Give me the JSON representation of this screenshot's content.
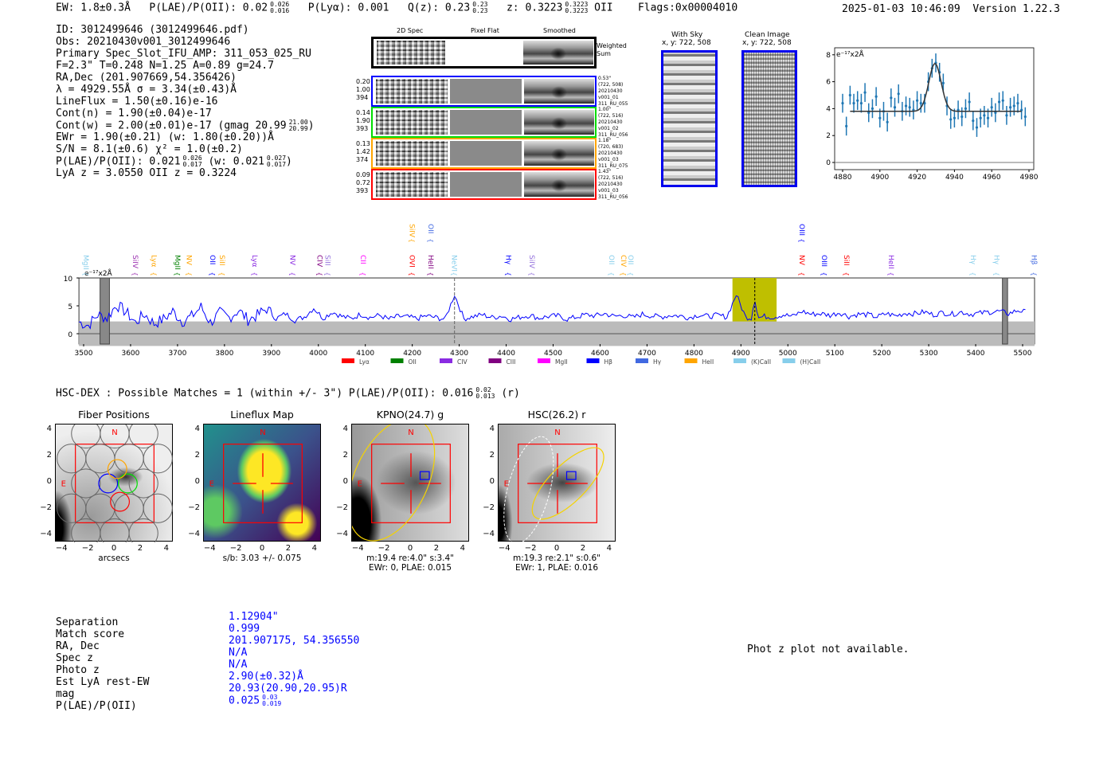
{
  "header": {
    "ew": "EW: 1.8±0.3Å",
    "plae_label": "P(LAE)/P(OII): 0.02",
    "plae_hi": "0.026",
    "plae_lo": "0.016",
    "plya": "P(Lyα): 0.001",
    "qz_label": "Q(z): 0.23",
    "qz_hi": "0.23",
    "qz_lo": "0.23",
    "z_label": "z: 0.3223",
    "z_hi": "0.3223",
    "z_lo": "0.3223",
    "z_line": "OII",
    "flags": "Flags:0x00004010",
    "datetime": "2025-01-03 10:46:09",
    "version": "Version 1.22.3"
  },
  "info": {
    "id": "ID: 3012499646 (3012499646.pdf)",
    "obs": "Obs: 20210430v001_3012499646",
    "primary": "Primary Spec_Slot_IFU_AMP: 311_053_025_RU",
    "params": "F=2.3\"  T=0.248  N=1.25  A=0.89  g=24.7",
    "radec": "RA,Dec (201.907669,54.356426)",
    "lambda": "λ = 4929.55Å   σ = 3.34(±0.43)Å",
    "lineflux": "LineFlux = 1.50(±0.16)e-16",
    "cont_n": "Cont(n) = 1.90(±0.04)e-17",
    "cont_w": "Cont(w) = 2.00(±0.01)e-17 (gmag 20.99",
    "cont_w_hi": "21.00",
    "cont_w_lo": "20.99",
    "cont_w_end": ")",
    "ewr": "EWr = 1.90(±0.21) (w: 1.80(±0.20))Å",
    "sn": "S/N = 8.1(±0.6)  χ² = 1.0(±0.2)",
    "plae": "P(LAE)/P(OII): 0.021",
    "plae_hi": "0.026",
    "plae_lo": "0.017",
    "plae_w": "(w: 0.021",
    "plae_w_hi": "0.027",
    "plae_w_lo": "0.017",
    "plae_w_end": ")",
    "z": "LyA z = 3.0550   OII z = 0.3224"
  },
  "spec2d": {
    "col_titles": [
      "2D Spec",
      "Pixel Flat",
      "Smoothed"
    ],
    "weighted_sum": "Weighted Sum",
    "rows": [
      {
        "color": "#0000ff",
        "vals": [
          "0.20",
          "1.00",
          "394"
        ],
        "meta": [
          "0.53\"",
          "(722, 508)",
          "20210430",
          "v001_01",
          "311_RU_055"
        ]
      },
      {
        "color": "#00dd00",
        "vals": [
          "0.14",
          "1.90",
          "393"
        ],
        "meta": [
          "1.00\"",
          "(722, 516)",
          "20210430",
          "v001_02",
          "311_RU_056"
        ]
      },
      {
        "color": "#ffa500",
        "vals": [
          "0.13",
          "1.42",
          "374"
        ],
        "meta": [
          "1.18\"",
          "(720, 683)",
          "20210430",
          "v001_03",
          "311_RU_075"
        ]
      },
      {
        "color": "#ff0000",
        "vals": [
          "0.09",
          "0.72",
          "393"
        ],
        "meta": [
          "1.43\"",
          "(722, 516)",
          "20210430",
          "v001_03",
          "311_RU_056"
        ]
      }
    ]
  },
  "sky": {
    "with_sky": "With Sky",
    "with_sky_xy": "x, y: 722, 508",
    "clean": "Clean Image",
    "clean_xy": "x, y: 722, 508"
  },
  "chart_data": [
    {
      "type": "scatter",
      "title": "line fit",
      "ylabel": "e⁻¹⁷x2Å",
      "xlim": [
        4876,
        4982
      ],
      "ylim": [
        -0.6,
        8.6
      ],
      "xticks": [
        4880,
        4900,
        4920,
        4940,
        4960,
        4980
      ],
      "yticks": [
        0,
        2,
        4,
        6,
        8
      ],
      "x": [
        4880,
        4882,
        4884,
        4886,
        4888,
        4890,
        4892,
        4894,
        4896,
        4898,
        4900,
        4902,
        4904,
        4906,
        4908,
        4910,
        4912,
        4914,
        4916,
        4918,
        4920,
        4922,
        4924,
        4926,
        4928,
        4930,
        4932,
        4934,
        4936,
        4938,
        4940,
        4942,
        4944,
        4946,
        4948,
        4950,
        4952,
        4954,
        4956,
        4958,
        4960,
        4962,
        4964,
        4966,
        4968,
        4970,
        4972,
        4974,
        4976,
        4978
      ],
      "y": [
        4.4,
        2.7,
        5.0,
        4.4,
        4.6,
        4.4,
        5.2,
        3.7,
        4.0,
        4.9,
        3.3,
        3.8,
        3.0,
        4.8,
        4.1,
        5.1,
        3.8,
        4.2,
        4.1,
        3.9,
        4.6,
        4.4,
        4.4,
        6.0,
        7.0,
        7.4,
        6.7,
        5.9,
        4.2,
        3.2,
        3.3,
        3.9,
        3.4,
        4.0,
        4.5,
        3.1,
        2.6,
        3.3,
        3.5,
        3.3,
        4.1,
        3.7,
        4.5,
        4.6,
        3.5,
        4.1,
        4.2,
        4.4,
        3.9,
        3.4
      ],
      "yerr": 0.7,
      "fit": {
        "continuum": 3.8,
        "amplitude": 3.55,
        "center": 4929.55,
        "sigma": 3.34,
        "range": [
          4884,
          4976
        ]
      }
    },
    {
      "type": "line",
      "title": "full spectrum",
      "ylabel": "e⁻¹⁷x2Å",
      "xlim": [
        3490,
        5525
      ],
      "ylim": [
        -1.9,
        10
      ],
      "xticks": [
        3500,
        3600,
        3700,
        3800,
        3900,
        4000,
        4100,
        4200,
        4300,
        4400,
        4500,
        4600,
        4700,
        4800,
        4900,
        5000,
        5100,
        5200,
        5300,
        5400,
        5500
      ],
      "yticks": [
        0,
        5,
        10
      ],
      "flux_step": 20,
      "flux_start": 3490,
      "flux": [
        2.1,
        1.5,
        3.4,
        2.8,
        5.2,
        3.9,
        2.0,
        3.5,
        1.8,
        2.6,
        4.0,
        2.2,
        3.1,
        4.8,
        2.0,
        3.7,
        2.9,
        4.2,
        2.5,
        3.3,
        4.5,
        2.7,
        3.6,
        2.4,
        3.0,
        4.6,
        2.8,
        3.9,
        3.1,
        2.7,
        3.5,
        2.9,
        3.3,
        2.6,
        3.1,
        3.0,
        2.7,
        3.2,
        2.9,
        2.6,
        7.0,
        2.7,
        3.1,
        3.4,
        2.9,
        3.2,
        2.6,
        3.0,
        3.3,
        2.8,
        3.1,
        3.2,
        2.6,
        3.0,
        3.4,
        3.2,
        3.6,
        3.1,
        3.3,
        2.9,
        3.5,
        3.2,
        3.0,
        3.3,
        3.2,
        2.9,
        3.4,
        3.1,
        3.3,
        3.0,
        7.0,
        3.0,
        2.7,
        3.1,
        3.0,
        3.4,
        3.1,
        4.0,
        3.5,
        3.6,
        3.3,
        3.8,
        3.1,
        3.5,
        3.4,
        3.0,
        3.6,
        3.2,
        3.7,
        3.6,
        3.9,
        3.4,
        3.8,
        3.5,
        3.9,
        3.5,
        3.7,
        3.9,
        4.0,
        3.6,
        4.2,
        3.8
      ],
      "noise_band": 2.2,
      "highlight": [
        4882,
        4976
      ],
      "line_center": 4929.55,
      "marker_line": 4290,
      "masked": [
        [
          3535,
          3555
        ],
        [
          5457,
          5468
        ]
      ],
      "line_labels": [
        {
          "name": "MgII",
          "w": 3505,
          "color": "#87ceeb"
        },
        {
          "name": "SiIV",
          "w": 3610,
          "color": "#9b30b0"
        },
        {
          "name": "Lyα",
          "w": 3650,
          "color": "#ffa500"
        },
        {
          "name": "MgII",
          "w": 3700,
          "color": "#008000"
        },
        {
          "name": "NV",
          "w": 3725,
          "color": "#ffa500"
        },
        {
          "name": "OII",
          "w": 3775,
          "color": "#0000ff"
        },
        {
          "name": "SiII",
          "w": 3795,
          "color": "#ffa500"
        },
        {
          "name": "Lyα",
          "w": 3865,
          "color": "#8a2be2"
        },
        {
          "name": "NV",
          "w": 3945,
          "color": "#8a2be2"
        },
        {
          "name": "CIV",
          "w": 4003,
          "color": "#800080"
        },
        {
          "name": "SiII",
          "w": 4020,
          "color": "#9370db"
        },
        {
          "name": "CII",
          "w": 4095,
          "color": "#ff00ff"
        },
        {
          "name": "OVI",
          "w": 4200,
          "color": "#ff0000"
        },
        {
          "name": "HeII",
          "w": 4240,
          "color": "#800080"
        },
        {
          "name": "NeVI",
          "w": 4290,
          "color": "#87ceeb"
        },
        {
          "name": "Hγ",
          "w": 4405,
          "color": "#0000ff"
        },
        {
          "name": "SiIV",
          "w": 4455,
          "color": "#9370db"
        },
        {
          "name": "OII",
          "w": 4625,
          "color": "#87ceeb"
        },
        {
          "name": "CIV",
          "w": 4650,
          "color": "#ffa500"
        },
        {
          "name": "OII",
          "w": 4665,
          "color": "#87ceeb"
        },
        {
          "name": "NV",
          "w": 5030,
          "color": "#ff0000"
        },
        {
          "name": "OIII",
          "w": 5078,
          "color": "#0000ff"
        },
        {
          "name": "SiII",
          "w": 5125,
          "color": "#ff0000"
        },
        {
          "name": "HeII",
          "w": 5220,
          "color": "#8a2be2"
        },
        {
          "name": "Hγ",
          "w": 5395,
          "color": "#87ceeb"
        },
        {
          "name": "Hγ",
          "w": 5445,
          "color": "#87ceeb"
        },
        {
          "name": "Hβ",
          "w": 5525,
          "color": "#4169e1"
        }
      ],
      "upper_labels": [
        {
          "name": "SiIV",
          "w": 4200,
          "color": "#ffa500"
        },
        {
          "name": "OII",
          "w": 4240,
          "color": "#4169e1"
        },
        {
          "name": "OIII",
          "w": 5030,
          "color": "#0000ff"
        }
      ],
      "legend": [
        {
          "name": "Lyα",
          "color": "#ff0000"
        },
        {
          "name": "OII",
          "color": "#008000"
        },
        {
          "name": "CIV",
          "color": "#8a2be2"
        },
        {
          "name": "CIII",
          "color": "#800080"
        },
        {
          "name": "MgII",
          "color": "#ff00ff"
        },
        {
          "name": "Hβ",
          "color": "#0000ff"
        },
        {
          "name": "Hγ",
          "color": "#4169e1"
        },
        {
          "name": "HeII",
          "color": "#ffa500"
        },
        {
          "name": "(K)CaII",
          "color": "#87ceeb"
        },
        {
          "name": "(H)CaII",
          "color": "#87ceeb"
        }
      ]
    }
  ],
  "hscdex": {
    "title": "HSC-DEX : Possible Matches = 1 (within +/- 3\")  P(LAE)/P(OII): 0.016",
    "hi": "0.02",
    "lo": "0.013",
    "end": "(r)"
  },
  "cutouts": [
    {
      "title": "Fiber Positions",
      "caption1": "arcsecs",
      "caption2": ""
    },
    {
      "title": "Lineflux Map",
      "caption1": "s/b: 3.03 +/- 0.075",
      "caption2": ""
    },
    {
      "title": "KPNO(24.7) g",
      "caption1": "m:19.4  re:4.0\"  s:3.4\"",
      "caption2": "EWr: 0, PLAE: 0.015"
    },
    {
      "title": "HSC(26.2) r",
      "caption1": "m:19.3  re:2.1\"  s:0.6\"",
      "caption2": "EWr: 1, PLAE: 0.016"
    }
  ],
  "cutout_ticks": [
    "−4",
    "−2",
    "0",
    "2",
    "4"
  ],
  "compass": {
    "n": "N",
    "e": "E"
  },
  "match": {
    "labels": [
      "Separation",
      "Match score",
      "RA, Dec",
      "Spec z",
      "Photo z",
      "Est LyA rest-EW",
      "mag",
      "P(LAE)/P(OII)"
    ],
    "values": [
      "1.12904\"",
      "0.999",
      "201.907175, 54.356550",
      "N/A",
      "N/A",
      "2.90(±0.32)Å",
      "20.93(20.90,20.95)R",
      "0.025"
    ],
    "plae_hi": "0.03",
    "plae_lo": "0.019"
  },
  "photz": "Phot z plot not available."
}
